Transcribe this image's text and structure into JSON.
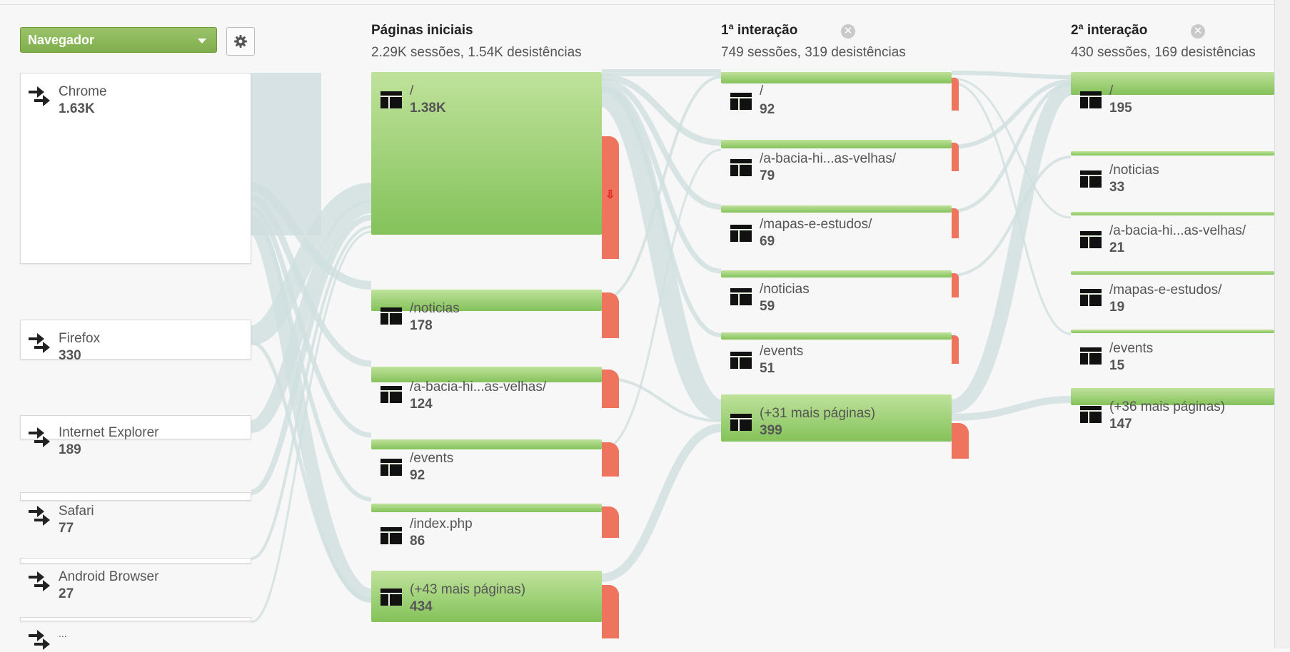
{
  "selector": {
    "label": "Navegador"
  },
  "columns": [
    {
      "title": "Páginas iniciais",
      "stats": "2.29K sessões, 1.54K desistências"
    },
    {
      "title": "1ª interação",
      "stats": "749 sessões, 319 desistências"
    },
    {
      "title": "2ª interação",
      "stats": "430 sessões, 169 desistências"
    }
  ],
  "sources": [
    {
      "name": "Chrome",
      "value": "1.63K"
    },
    {
      "name": "Firefox",
      "value": "330"
    },
    {
      "name": "Internet Explorer",
      "value": "189"
    },
    {
      "name": "Safari",
      "value": "77"
    },
    {
      "name": "Android Browser",
      "value": "27"
    },
    {
      "name": "...",
      "value": ""
    }
  ],
  "start_pages": [
    {
      "page": "/",
      "value": "1.38K"
    },
    {
      "page": "/noticias",
      "value": "178"
    },
    {
      "page": "/a-bacia-hi...as-velhas/",
      "value": "124"
    },
    {
      "page": "/events",
      "value": "92"
    },
    {
      "page": "/index.php",
      "value": "86"
    },
    {
      "page": "(+43 mais páginas)",
      "value": "434"
    }
  ],
  "first_interaction": [
    {
      "page": "/",
      "value": "92"
    },
    {
      "page": "/a-bacia-hi...as-velhas/",
      "value": "79"
    },
    {
      "page": "/mapas-e-estudos/",
      "value": "69"
    },
    {
      "page": "/noticias",
      "value": "59"
    },
    {
      "page": "/events",
      "value": "51"
    },
    {
      "page": "(+31 mais páginas)",
      "value": "399"
    }
  ],
  "second_interaction": [
    {
      "page": "/",
      "value": "195"
    },
    {
      "page": "/noticias",
      "value": "33"
    },
    {
      "page": "/a-bacia-hi...as-velhas/",
      "value": "21"
    },
    {
      "page": "/mapas-e-estudos/",
      "value": "19"
    },
    {
      "page": "/events",
      "value": "15"
    },
    {
      "page": "(+36 mais páginas)",
      "value": "147"
    }
  ],
  "colors": {
    "node_green": "#84c25a",
    "dropoff_red": "#ef745d",
    "flow": "#c9d9da",
    "selector": "#8db85a"
  }
}
